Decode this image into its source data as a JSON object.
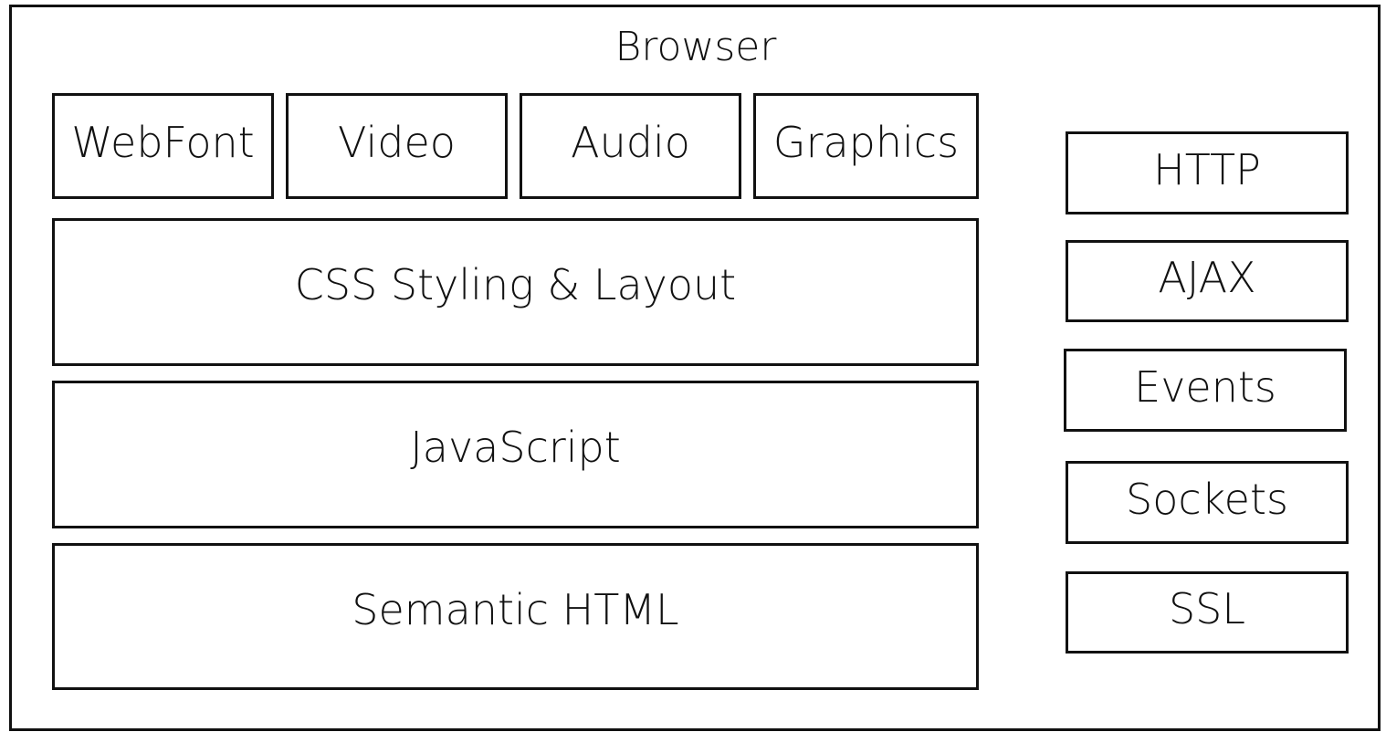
{
  "diagram": {
    "title": "Browser",
    "features": [
      {
        "label": "WebFont"
      },
      {
        "label": "Video"
      },
      {
        "label": "Audio"
      },
      {
        "label": "Graphics"
      }
    ],
    "layers": [
      {
        "label": "CSS Styling & Layout"
      },
      {
        "label": "JavaScript"
      },
      {
        "label": "Semantic HTML"
      }
    ],
    "services": [
      {
        "label": "HTTP"
      },
      {
        "label": "AJAX"
      },
      {
        "label": "Events"
      },
      {
        "label": "Sockets"
      },
      {
        "label": "SSL"
      }
    ]
  }
}
